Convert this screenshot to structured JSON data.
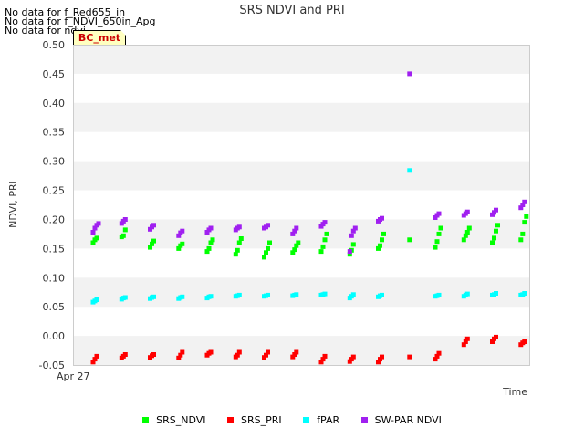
{
  "messages": [
    "No data for f_Red655_in",
    "No data for f_NDVI_650in_Apg",
    "No data for ndvi"
  ],
  "station_tag": "BC_met",
  "chart_data": {
    "type": "scatter",
    "title": "SRS NDVI and PRI",
    "xlabel": "Time",
    "ylabel": "NDVI, PRI",
    "x_tick_labels": [
      "Apr 27"
    ],
    "ylim": [
      -0.05,
      0.5
    ],
    "y_ticks": [
      "-0.05",
      "0.00",
      "0.05",
      "0.10",
      "0.15",
      "0.20",
      "0.25",
      "0.30",
      "0.35",
      "0.40",
      "0.45",
      "0.50"
    ],
    "days": [
      1,
      2,
      3,
      4,
      5,
      6,
      7,
      8,
      9,
      10,
      11,
      12,
      13,
      14,
      15,
      16
    ],
    "series": [
      {
        "name": "SRS_NDVI",
        "color": "#00ff00",
        "values": [
          [
            0.16,
            0.165,
            0.168
          ],
          [
            0.17,
            0.172,
            0.182
          ],
          [
            0.152,
            0.158,
            0.163
          ],
          [
            0.15,
            0.155,
            0.158
          ],
          [
            0.145,
            0.15,
            0.16,
            0.165
          ],
          [
            0.14,
            0.147,
            0.16,
            0.167
          ],
          [
            0.135,
            0.143,
            0.15,
            0.16
          ],
          [
            0.143,
            0.148,
            0.155,
            0.16
          ],
          [
            0.145,
            0.153,
            0.165,
            0.175
          ],
          [
            0.14,
            0.147,
            0.157
          ],
          [
            0.15,
            0.155,
            0.165,
            0.175
          ],
          [
            0.165
          ],
          [
            0.152,
            0.162,
            0.175,
            0.185
          ],
          [
            0.165,
            0.172,
            0.178,
            0.185
          ],
          [
            0.16,
            0.168,
            0.18,
            0.19
          ],
          [
            0.165,
            0.175,
            0.195,
            0.205
          ]
        ]
      },
      {
        "name": "SRS_PRI",
        "color": "#ff0000",
        "values": [
          [
            -0.045,
            -0.04,
            -0.035
          ],
          [
            -0.038,
            -0.035,
            -0.032
          ],
          [
            -0.037,
            -0.034,
            -0.032
          ],
          [
            -0.038,
            -0.033,
            -0.028
          ],
          [
            -0.033,
            -0.03,
            -0.028
          ],
          [
            -0.036,
            -0.033,
            -0.028
          ],
          [
            -0.037,
            -0.033,
            -0.028
          ],
          [
            -0.036,
            -0.032,
            -0.028
          ],
          [
            -0.045,
            -0.04,
            -0.035
          ],
          [
            -0.044,
            -0.04,
            -0.036
          ],
          [
            -0.045,
            -0.04,
            -0.036
          ],
          [
            -0.036
          ],
          [
            -0.04,
            -0.035,
            -0.03
          ],
          [
            -0.015,
            -0.01,
            -0.005
          ],
          [
            -0.01,
            -0.005,
            -0.002
          ],
          [
            -0.015,
            -0.012,
            -0.01
          ]
        ]
      },
      {
        "name": "fPAR",
        "color": "#00ffff",
        "values": [
          [
            0.058,
            0.06,
            0.062
          ],
          [
            0.063,
            0.065,
            0.066
          ],
          [
            0.064,
            0.066,
            0.067
          ],
          [
            0.064,
            0.066,
            0.067
          ],
          [
            0.065,
            0.067,
            0.068
          ],
          [
            0.068,
            0.069,
            0.07
          ],
          [
            0.068,
            0.069,
            0.07
          ],
          [
            0.069,
            0.07,
            0.071
          ],
          [
            0.07,
            0.071,
            0.072
          ],
          [
            0.065,
            0.068,
            0.071
          ],
          [
            0.067,
            0.069,
            0.07
          ],
          [
            0.284
          ],
          [
            0.068,
            0.069,
            0.07
          ],
          [
            0.068,
            0.07,
            0.072
          ],
          [
            0.07,
            0.071,
            0.073
          ],
          [
            0.07,
            0.071,
            0.073
          ]
        ]
      },
      {
        "name": "SW-PAR NDVI",
        "color": "#a020f0",
        "values": [
          [
            0.178,
            0.185,
            0.19,
            0.193
          ],
          [
            0.193,
            0.197,
            0.2
          ],
          [
            0.183,
            0.187,
            0.19
          ],
          [
            0.172,
            0.177,
            0.18
          ],
          [
            0.178,
            0.182,
            0.185
          ],
          [
            0.182,
            0.185,
            0.187
          ],
          [
            0.185,
            0.187,
            0.19
          ],
          [
            0.175,
            0.18,
            0.185
          ],
          [
            0.188,
            0.192,
            0.195
          ],
          [
            0.145,
            0.172,
            0.18,
            0.185
          ],
          [
            0.197,
            0.2,
            0.202
          ],
          [
            0.45
          ],
          [
            0.203,
            0.207,
            0.21
          ],
          [
            0.207,
            0.21,
            0.213
          ],
          [
            0.208,
            0.212,
            0.216
          ],
          [
            0.22,
            0.225,
            0.23
          ]
        ]
      }
    ]
  }
}
